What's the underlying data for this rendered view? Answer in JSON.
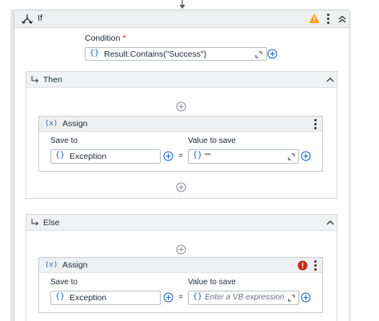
{
  "if_activity": {
    "title": "If",
    "condition_label": "Condition",
    "required_marker": "*",
    "condition_value": "Result.Contains(\"Success\")"
  },
  "then_branch": {
    "title": "Then",
    "assign": {
      "title": "Assign",
      "save_to_label": "Save to",
      "save_to_value": "Exception",
      "value_to_save_label": "Value to save",
      "value_to_save_value": "\"\"",
      "equals": "="
    }
  },
  "else_branch": {
    "title": "Else",
    "assign": {
      "title": "Assign",
      "save_to_label": "Save to",
      "save_to_value": "Exception",
      "value_to_save_label": "Value to save",
      "value_to_save_placeholder": "Enter a VB expression",
      "equals": "=",
      "has_error": true
    }
  },
  "glyphs": {
    "braces": "{}",
    "assign_icon": "(x)"
  },
  "colors": {
    "accent": "#1565c0",
    "warning": "#f59e0b",
    "error": "#c42b1c",
    "header_bg": "#eef0f2"
  }
}
